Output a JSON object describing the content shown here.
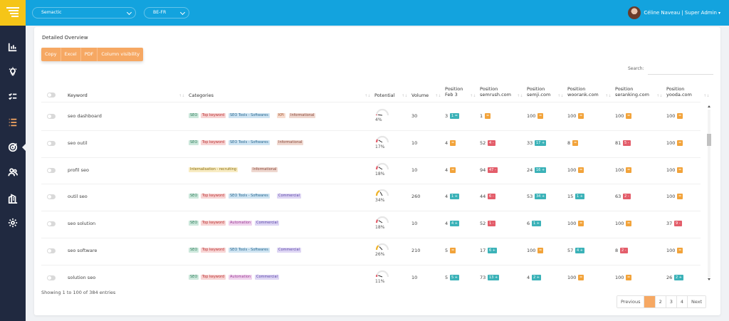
{
  "app": {
    "project": "Semactic",
    "locale": "BE-FR",
    "user_name": "Céline Naveau | Super Admin",
    "logo": "list-bars-logo",
    "colors": {
      "topbar": "#13a3de",
      "sidebar": "#202940",
      "logo_bg": "#f5c518",
      "accent": "#f6a863"
    }
  },
  "sidebar": {
    "items": [
      {
        "icon": "bar-chart-icon",
        "active": false
      },
      {
        "icon": "lightbulb-icon",
        "active": false
      },
      {
        "icon": "checklist-icon",
        "active": false
      },
      {
        "icon": "list-icon",
        "active": true
      },
      {
        "icon": "target-icon",
        "active": false
      },
      {
        "icon": "users-icon",
        "active": false
      },
      {
        "icon": "buildings-icon",
        "active": false
      },
      {
        "icon": "gear-icon",
        "active": false
      }
    ]
  },
  "overview": {
    "title": "Detailed Overview",
    "buttons": [
      "Copy",
      "Excel",
      "PDF",
      "Column visibility"
    ],
    "search_label": "Search:",
    "search_value": "",
    "columns": [
      "Keyword",
      "Categories",
      "Potential",
      "Volume",
      "Position\nFeb 3",
      "Position\nsemrush.com",
      "Position\nsemji.com",
      "Position\nwoorank.com",
      "Position\nseranking.com",
      "Position\nyooda.com"
    ],
    "rows": [
      {
        "keyword": "seo dashboard",
        "categories": [
          "SEO",
          "Top keyword",
          "SEO Tools - Softwares",
          "KPI",
          "Informational"
        ],
        "potential": "4%",
        "potential_value": 4,
        "volume": "30",
        "positions": [
          {
            "n": "3",
            "b": "1 =",
            "c": "teal"
          },
          {
            "n": "1",
            "b": "=",
            "c": "orange"
          },
          {
            "n": "100",
            "b": "=",
            "c": "orange"
          },
          {
            "n": "100",
            "b": "=",
            "c": "orange"
          },
          {
            "n": "100",
            "b": "=",
            "c": "orange"
          },
          {
            "n": "100",
            "b": "=",
            "c": "orange"
          }
        ]
      },
      {
        "keyword": "seo outil",
        "categories": [
          "SEO",
          "Top keyword",
          "SEO Tools - Softwares",
          "Informational"
        ],
        "potential": "17%",
        "potential_value": 17,
        "volume": "10",
        "positions": [
          {
            "n": "4",
            "b": "=",
            "c": "orange"
          },
          {
            "n": "52",
            "b": "4 -",
            "c": "red"
          },
          {
            "n": "33",
            "b": "17 +",
            "c": "teal"
          },
          {
            "n": "8",
            "b": "=",
            "c": "orange"
          },
          {
            "n": "81",
            "b": "5 -",
            "c": "red"
          },
          {
            "n": "100",
            "b": "=",
            "c": "orange"
          }
        ]
      },
      {
        "keyword": "profil seo",
        "categories": [
          "Internalisation - recruiting",
          "Informational"
        ],
        "potential": "18%",
        "potential_value": 18,
        "volume": "10",
        "positions": [
          {
            "n": "4",
            "b": "=",
            "c": "orange"
          },
          {
            "n": "94",
            "b": "47 -",
            "c": "red"
          },
          {
            "n": "24",
            "b": "16 +",
            "c": "teal"
          },
          {
            "n": "100",
            "b": "=",
            "c": "orange"
          },
          {
            "n": "100",
            "b": "=",
            "c": "orange"
          },
          {
            "n": "100",
            "b": "=",
            "c": "orange"
          }
        ]
      },
      {
        "keyword": "outil seo",
        "categories": [
          "SEO",
          "Top keyword",
          "SEO Tools - Softwares",
          "Commercial"
        ],
        "potential": "34%",
        "potential_value": 34,
        "volume": "260",
        "positions": [
          {
            "n": "4",
            "b": "1 +",
            "c": "teal"
          },
          {
            "n": "44",
            "b": "6 -",
            "c": "red"
          },
          {
            "n": "53",
            "b": "34 +",
            "c": "teal"
          },
          {
            "n": "15",
            "b": "1 +",
            "c": "teal"
          },
          {
            "n": "63",
            "b": "2 -",
            "c": "red"
          },
          {
            "n": "100",
            "b": "=",
            "c": "orange"
          }
        ]
      },
      {
        "keyword": "seo solution",
        "categories": [
          "SEO",
          "Top keyword",
          "Automation",
          "Commercial"
        ],
        "potential": "18%",
        "potential_value": 18,
        "volume": "10",
        "positions": [
          {
            "n": "4",
            "b": "4 +",
            "c": "teal"
          },
          {
            "n": "52",
            "b": "1 -",
            "c": "red"
          },
          {
            "n": "6",
            "b": "1 +",
            "c": "teal"
          },
          {
            "n": "100",
            "b": "=",
            "c": "orange"
          },
          {
            "n": "100",
            "b": "=",
            "c": "orange"
          },
          {
            "n": "37",
            "b": "9 -",
            "c": "red"
          }
        ]
      },
      {
        "keyword": "seo software",
        "categories": [
          "SEO",
          "Top keyword",
          "SEO Tools - Softwares",
          "Commercial"
        ],
        "potential": "26%",
        "potential_value": 26,
        "volume": "210",
        "positions": [
          {
            "n": "5",
            "b": "=",
            "c": "orange"
          },
          {
            "n": "17",
            "b": "6 +",
            "c": "teal"
          },
          {
            "n": "100",
            "b": "=",
            "c": "orange"
          },
          {
            "n": "57",
            "b": "4 +",
            "c": "teal"
          },
          {
            "n": "8",
            "b": "2 -",
            "c": "red"
          },
          {
            "n": "100",
            "b": "=",
            "c": "orange"
          }
        ]
      },
      {
        "keyword": "solution seo",
        "categories": [
          "SEO",
          "Top keyword",
          "Automation",
          "Commercial"
        ],
        "potential": "11%",
        "potential_value": 11,
        "volume": "10",
        "positions": [
          {
            "n": "5",
            "b": "5 +",
            "c": "teal"
          },
          {
            "n": "73",
            "b": "13 +",
            "c": "teal"
          },
          {
            "n": "4",
            "b": "2 +",
            "c": "teal"
          },
          {
            "n": "100",
            "b": "=",
            "c": "orange"
          },
          {
            "n": "100",
            "b": "=",
            "c": "orange"
          },
          {
            "n": "26",
            "b": "2 +",
            "c": "teal"
          }
        ]
      }
    ],
    "showing": "Showing 1 to 100 of 384 entries",
    "pagination": {
      "previous": "Previous",
      "pages": [
        "1",
        "2",
        "3",
        "4"
      ],
      "current": "1",
      "next": "Next"
    }
  }
}
